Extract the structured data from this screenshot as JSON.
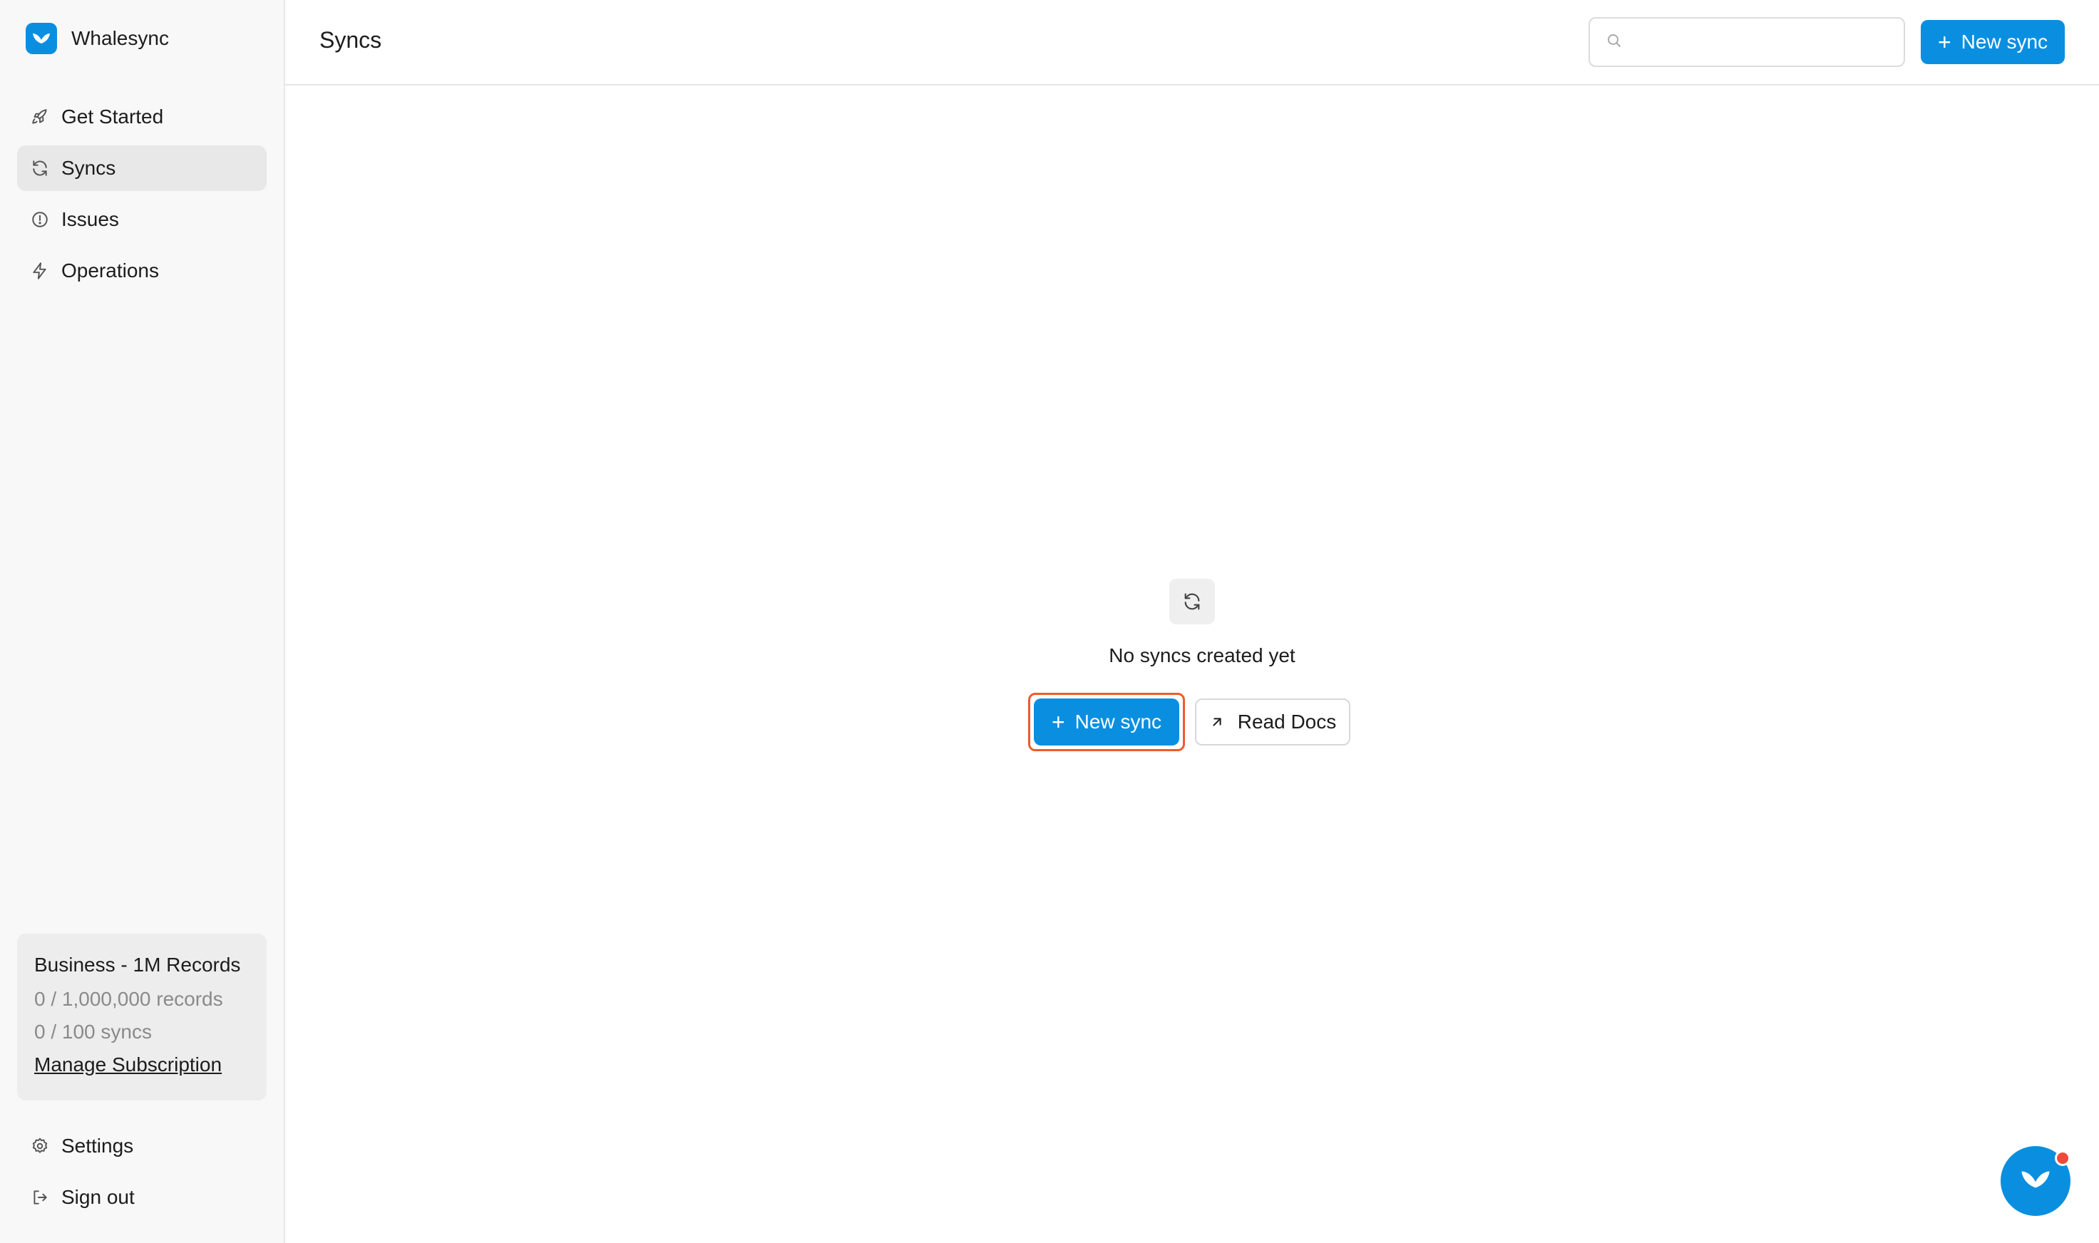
{
  "brand": {
    "name": "Whalesync",
    "logo_icon": "whale-tail-icon",
    "color": "#0a8fe0"
  },
  "sidebar": {
    "items": [
      {
        "label": "Get Started",
        "icon": "rocket-icon",
        "active": false
      },
      {
        "label": "Syncs",
        "icon": "refresh-icon",
        "active": true
      },
      {
        "label": "Issues",
        "icon": "alert-circle-icon",
        "active": false
      },
      {
        "label": "Operations",
        "icon": "bolt-icon",
        "active": false
      }
    ],
    "plan": {
      "title": "Business - 1M Records",
      "records": "0 / 1,000,000 records",
      "syncs": "0 / 100 syncs",
      "manage_link": "Manage Subscription"
    },
    "bottom_items": [
      {
        "label": "Settings",
        "icon": "gear-icon"
      },
      {
        "label": "Sign out",
        "icon": "sign-out-icon"
      }
    ]
  },
  "header": {
    "title": "Syncs",
    "search_placeholder": "",
    "new_sync_label": "New sync"
  },
  "empty_state": {
    "icon": "refresh-icon",
    "message": "No syncs created yet",
    "new_sync_label": "New sync",
    "read_docs_label": "Read Docs",
    "highlight_color": "#f05a2a"
  },
  "chat": {
    "icon": "whale-tail-icon",
    "notification_color": "#f04a3a"
  }
}
